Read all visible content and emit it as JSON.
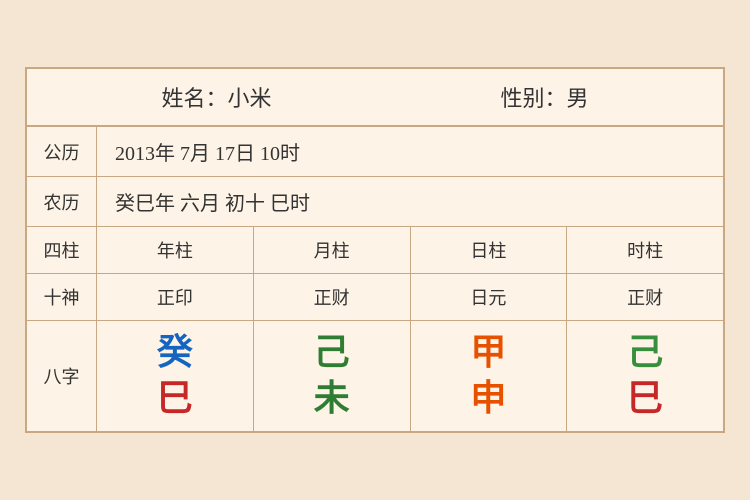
{
  "header": {
    "name_label": "姓名：小米",
    "gender_label": "性别：男"
  },
  "solar": {
    "label": "公历",
    "value": "2013年 7月 17日 10时"
  },
  "lunar": {
    "label": "农历",
    "value": "癸巳年 六月 初十 巳时"
  },
  "columns": {
    "label": "四柱",
    "headers": [
      "年柱",
      "月柱",
      "日柱",
      "时柱"
    ]
  },
  "shishen": {
    "label": "十神",
    "values": [
      "正印",
      "正财",
      "日元",
      "正财"
    ]
  },
  "bazi": {
    "label": "八字",
    "cells": [
      {
        "top": "癸",
        "bottom": "巳",
        "top_color": "color-blue",
        "bottom_color": "color-red"
      },
      {
        "top": "己",
        "bottom": "未",
        "top_color": "color-green",
        "bottom_color": "color-green"
      },
      {
        "top": "甲",
        "bottom": "申",
        "top_color": "color-orange",
        "bottom_color": "color-orange"
      },
      {
        "top": "己",
        "bottom": "巳",
        "top_color": "color-green2",
        "bottom_color": "color-red"
      }
    ]
  }
}
